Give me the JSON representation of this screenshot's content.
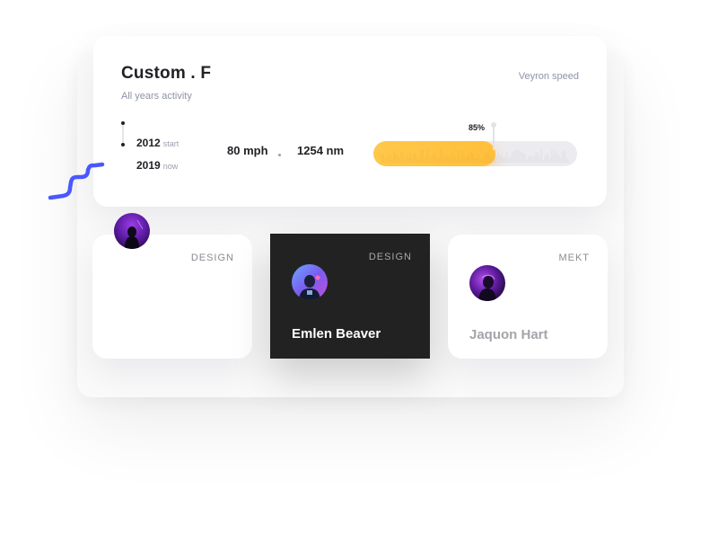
{
  "stats": {
    "title": "Custom . F",
    "subtitle": "All years activity",
    "top_right_label": "Veyron speed",
    "timeline": [
      {
        "year": "2012",
        "note": "start"
      },
      {
        "year": "2019",
        "note": "now"
      }
    ],
    "speed": "80 mph",
    "separator": ".",
    "torque": "1254 nm",
    "progress": {
      "label": "85%",
      "percent": 60
    },
    "accent_color": "#ffc84a"
  },
  "profiles": [
    {
      "tag": "DESIGN",
      "name": "",
      "style": "light"
    },
    {
      "tag": "DESIGN",
      "name": "Emlen Beaver",
      "style": "dark"
    },
    {
      "tag": "MEKT",
      "name": "Jaquon Hart",
      "style": "light"
    }
  ],
  "squiggle_color": "#4a57ff"
}
